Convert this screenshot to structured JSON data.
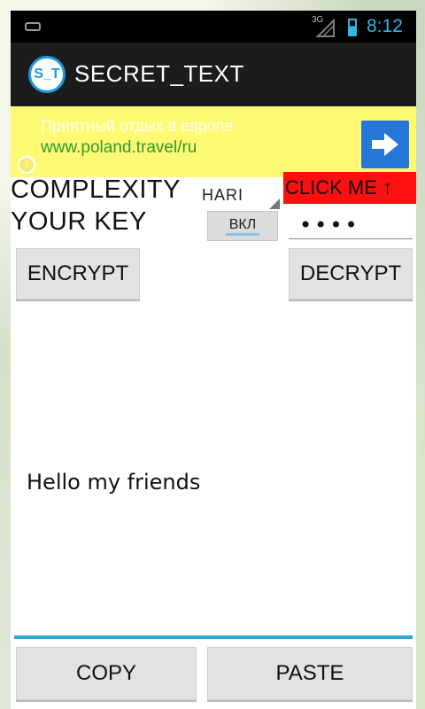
{
  "status_bar": {
    "network_label": "3G",
    "time": "8:12",
    "icons": [
      "keyboard-icon",
      "signal-icon",
      "battery-icon"
    ]
  },
  "app": {
    "icon_text": "S_T",
    "title": "SECRET_TEXT"
  },
  "ad": {
    "line1": "Приятный отдых в европе",
    "line2": "www.poland.travel/ru",
    "info_icon": "i",
    "arrow_icon": "right-arrow-icon"
  },
  "controls": {
    "complexity_label": "COMPLEXITY",
    "complexity_value": "HARI",
    "click_me": "CLICK ME ↑",
    "key_label": "YOUR KEY",
    "toggle_label": "ВКЛ",
    "key_value": "••••"
  },
  "buttons": {
    "encrypt": "ENCRYPT",
    "decrypt": "DECRYPT",
    "copy": "COPY",
    "paste": "PASTE"
  },
  "message": {
    "text": "Hello my friends"
  },
  "colors": {
    "statusbar": "#000000",
    "accent_blue": "#33b5e5",
    "actionbar": "#1c1c1c",
    "ad_background": "#fffa74",
    "ad_link": "#2d9a2d",
    "ad_button": "#2777d8",
    "click_me_bg": "#ff1010",
    "button_bg": "#e2e2e2",
    "text_underline": "#2ea7d8"
  }
}
